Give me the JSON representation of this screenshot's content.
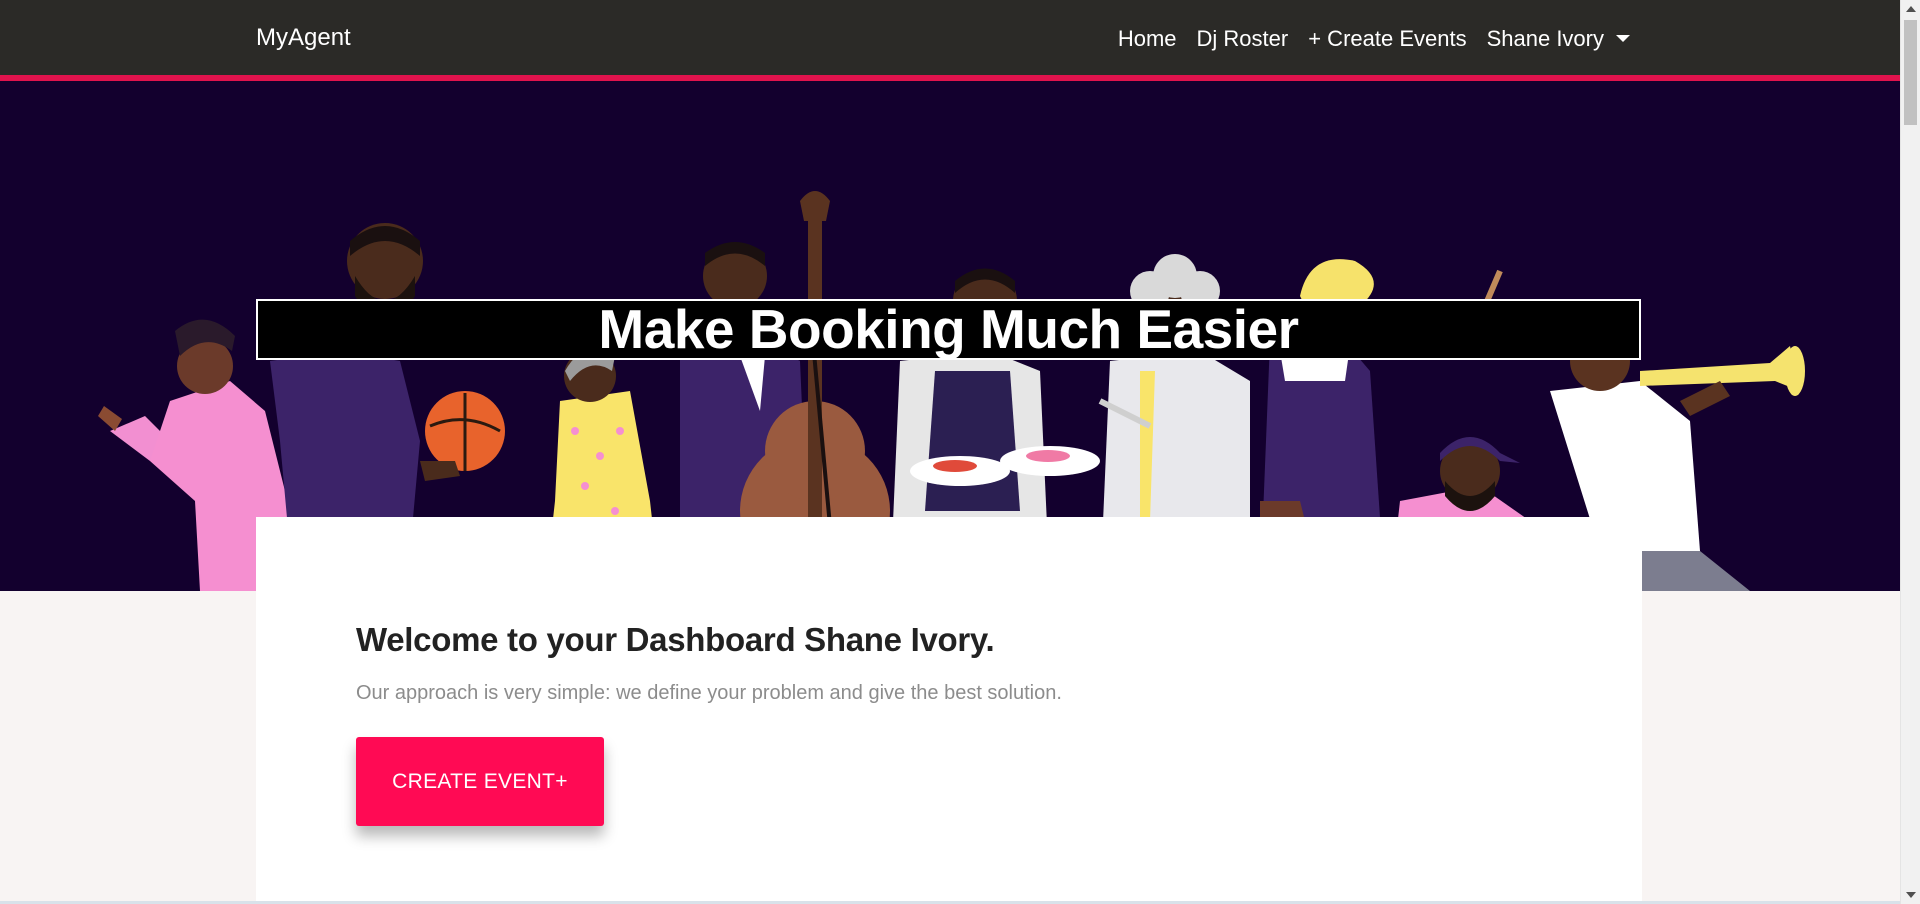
{
  "navbar": {
    "brand": "MyAgent",
    "links": {
      "home": "Home",
      "dj_roster": "Dj Roster",
      "create_events": "+ Create Events",
      "user": "Shane Ivory"
    }
  },
  "hero": {
    "title": "Make Booking Much Easier"
  },
  "card": {
    "welcome": "Welcome to your Dashboard Shane Ivory.",
    "subtext": "Our approach is very simple: we define your problem and give the best solution.",
    "cta_label": "CREATE EVENT+"
  },
  "colors": {
    "navbar_bg": "#2b2a27",
    "accent": "#e0134d",
    "cta_bg": "#ff0a54",
    "hero_bg": "#13002e",
    "page_bg": "#f8f4f3"
  },
  "icons": {
    "user_menu": "caret-down-icon"
  }
}
